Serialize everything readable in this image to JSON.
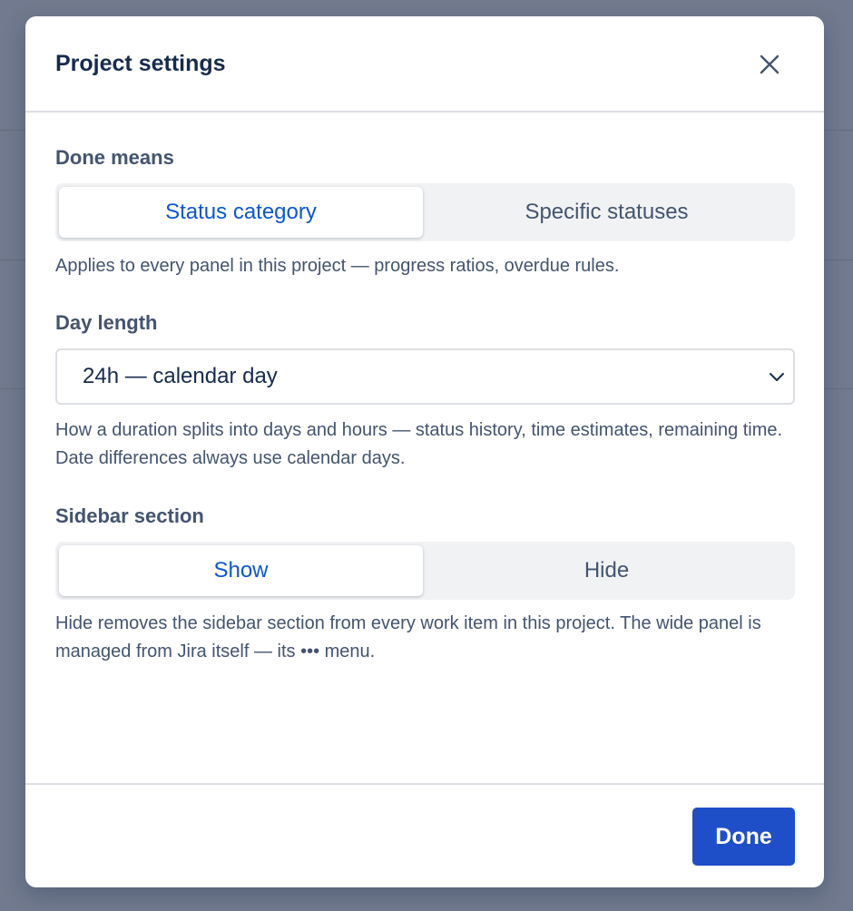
{
  "modal": {
    "title": "Project settings",
    "close_icon": "close-icon"
  },
  "done_means": {
    "label": "Done means",
    "options": [
      "Status category",
      "Specific statuses"
    ],
    "selected": "Status category",
    "help": "Applies to every panel in this project — progress ratios, overdue rules."
  },
  "day_length": {
    "label": "Day length",
    "value": "24h — calendar day",
    "chevron_icon": "chevron-down-icon",
    "help": "How a duration splits into days and hours — status history, time estimates, remaining time. Date differences always use calendar days."
  },
  "sidebar_section": {
    "label": "Sidebar section",
    "options": [
      "Show",
      "Hide"
    ],
    "selected": "Show",
    "help": "Hide removes the sidebar section from every work item in this project. The wide panel is managed from Jira itself — its ••• menu."
  },
  "footer": {
    "done_label": "Done"
  },
  "colors": {
    "accent": "#0c56d0",
    "primary_button": "#1f4fc8",
    "backdrop": "#717a8e",
    "text": "#172b4d",
    "subtle_text": "#44546f"
  }
}
